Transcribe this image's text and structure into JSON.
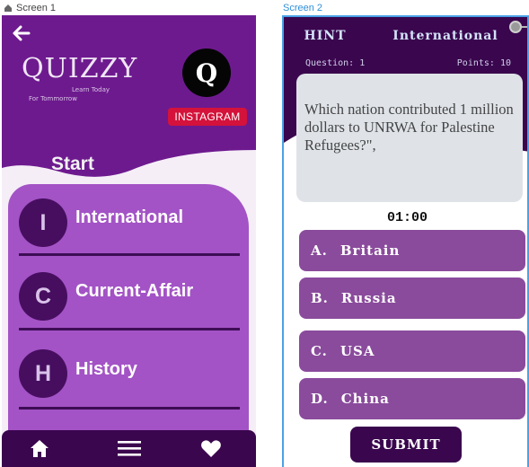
{
  "screens": {
    "screen1_label": "Screen 1",
    "screen2_label": "Screen 2"
  },
  "screen1": {
    "app_title": "QUIZZY",
    "tagline_line1": "Learn Today",
    "tagline_line2": "For Tommorrow",
    "logo_letter": "Q",
    "instagram_label": "INSTAGRAM",
    "start_label": "Start",
    "categories": [
      {
        "letter": "I",
        "label": "International"
      },
      {
        "letter": "C",
        "label": "Current-Affair"
      },
      {
        "letter": "H",
        "label": "History"
      }
    ],
    "nav": {
      "items": [
        "home-icon",
        "menu-icon",
        "heart-icon"
      ]
    }
  },
  "screen2": {
    "hint_label": "HINT",
    "category_title": "International",
    "question_label": "Question: 1",
    "points_label": "Points: 10",
    "question_text": "Which nation contributed 1 million dollars to UNRWA for Palestine Refugees?\",",
    "timer": "01:00",
    "answers": [
      {
        "letter": "A.",
        "text": "Britain"
      },
      {
        "letter": "B.",
        "text": "Russia"
      },
      {
        "letter": "C.",
        "text": "USA"
      },
      {
        "letter": "D.",
        "text": "China"
      }
    ],
    "submit_label": "SUBMIT"
  },
  "colors": {
    "primary_dark": "#3a064e",
    "header_purple": "#6e1a8f",
    "card_purple": "#a353c5",
    "answer_purple": "#8a4b9c",
    "instagram_red": "#d4123b"
  }
}
